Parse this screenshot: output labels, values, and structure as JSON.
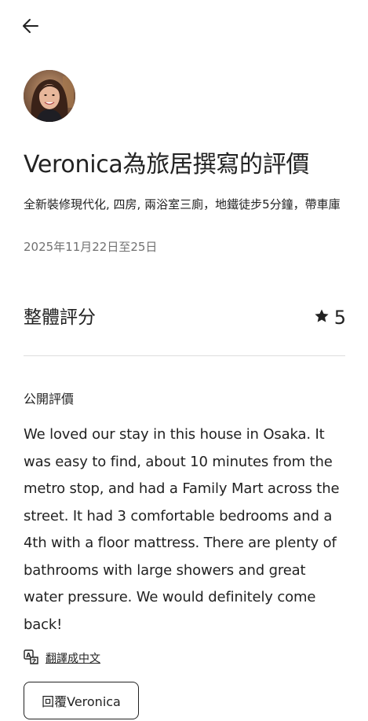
{
  "header": {
    "back_icon": "arrow-left-icon"
  },
  "reviewer": {
    "avatar_icon": "reviewer-avatar"
  },
  "page": {
    "title": "Veronica為旅居撰寫的評價",
    "listing_name": "全新裝修現代化, 四房, 兩浴室三廁，地鐵徒步5分鐘，帶車庫",
    "stay_dates": "2025年11月22日至25日"
  },
  "rating": {
    "label": "整體評分",
    "score": "5",
    "icon": "star-icon"
  },
  "review": {
    "section_label": "公開評價",
    "text": "We loved our stay in this house in Osaka. It was easy to find, about 10 minutes from the metro stop, and had a Family Mart across the street. It had 3 comfortable bedrooms and a 4th with a floor mattress. There are plenty of bathrooms with large showers and great water pressure. We would definitely come back!",
    "translate_label": "翻譯成中文",
    "translate_icon": "translate-icon"
  },
  "actions": {
    "reply_label": "回覆Veronica"
  },
  "colors": {
    "text_primary": "#222222",
    "text_secondary": "#717171",
    "divider": "#dddddd",
    "background": "#ffffff"
  }
}
